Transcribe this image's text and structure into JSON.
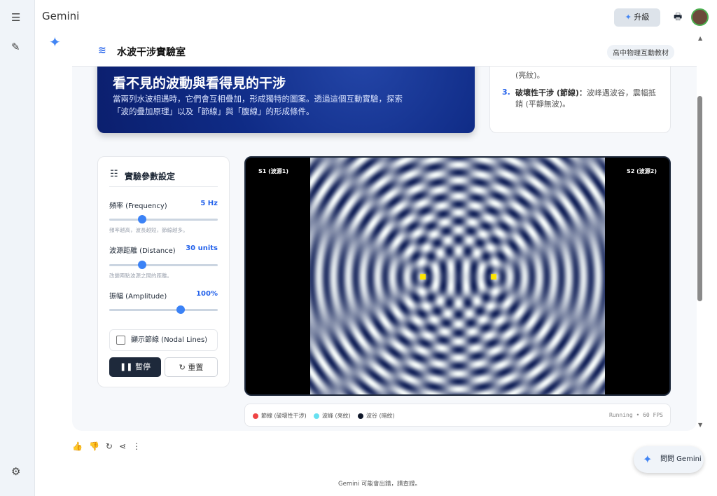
{
  "app": {
    "title": "Gemini",
    "upgrade_label": "升級",
    "footer": "Gemini 可能會出錯，請查證。",
    "ask_label": "問問 Gemini"
  },
  "panel": {
    "title": "水波干涉實驗室",
    "tag": "高中物理互動教材",
    "hero": {
      "title": "看不見的波動與看得見的干涉",
      "text": "當兩列水波相遇時，它們會互相疊加，形成獨特的圖案。透過這個互動實驗，探索「波的疊加原理」以及「節線」與「腹線」的形成條件。"
    },
    "info": {
      "partial": "(亮紋)。",
      "num": "3.",
      "term": "破壞性干涉 (節線)：",
      "desc": "波峰遇波谷，震幅抵銷 (平靜無波)。"
    }
  },
  "controls": {
    "title": "實驗參數設定",
    "params": [
      {
        "label": "頻率 (Frequency)",
        "value": "5 Hz",
        "hint": "頻率越高，波長越短，節線越多。",
        "fraction": 0.3
      },
      {
        "label": "波源距離 (Distance)",
        "value": "30 units",
        "hint": "改變兩點波源之間的距離。",
        "fraction": 0.3
      },
      {
        "label": "振幅 (Amplitude)",
        "value": "100%",
        "hint": "",
        "fraction": 0.66
      }
    ],
    "nodal_lines_label": "顯示節線 (Nodal Lines)",
    "nodal_lines_checked": false,
    "pause_label": "暫停",
    "reset_label": "重置"
  },
  "sim": {
    "s1": "S1 (波源1)",
    "s2": "S2 (波源2)",
    "source_color": "#ffe600",
    "wave_color": "#14235a"
  },
  "legend": {
    "items": [
      {
        "label": "節線 (破壞性干涉)",
        "color": "#ef4444"
      },
      {
        "label": "波峰 (亮紋)",
        "color": "#67e0f0"
      },
      {
        "label": "波谷 (暗紋)",
        "color": "#0f172a"
      }
    ],
    "status": "Running • 60 FPS"
  }
}
